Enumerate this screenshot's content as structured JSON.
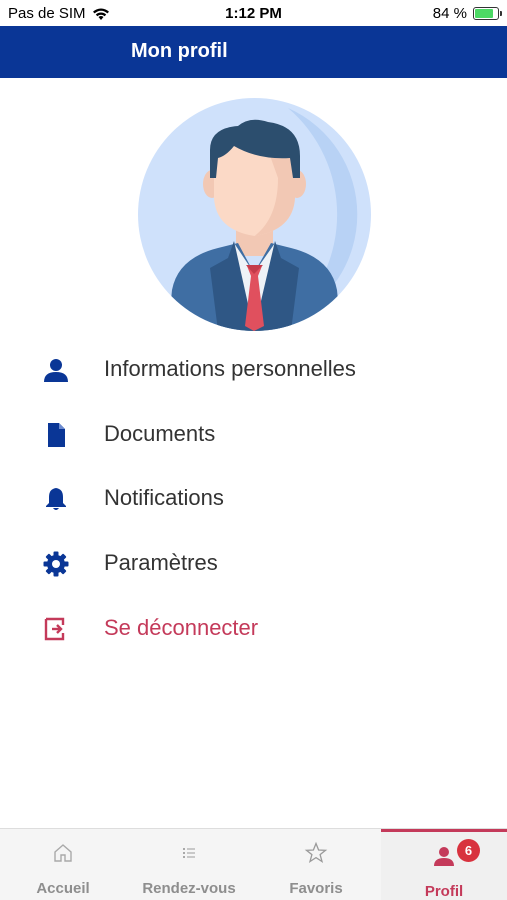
{
  "status_bar": {
    "carrier": "Pas de SIM",
    "time": "1:12 PM",
    "battery_text": "84 %",
    "battery_level": 0.84
  },
  "app_bar": {
    "title": "Mon profil"
  },
  "avatar": {
    "icon": "businessman-avatar-icon"
  },
  "menu": {
    "items": [
      {
        "label": "Informations personnelles",
        "icon": "user-icon"
      },
      {
        "label": "Documents",
        "icon": "document-icon"
      },
      {
        "label": "Notifications",
        "icon": "bell-icon"
      },
      {
        "label": "Paramètres",
        "icon": "gear-icon"
      },
      {
        "label": "Se déconnecter",
        "icon": "logout-icon"
      }
    ]
  },
  "bottom_nav": {
    "items": [
      {
        "label": "Accueil",
        "icon": "home-icon",
        "active": false
      },
      {
        "label": "Rendez-vous",
        "icon": "list-icon",
        "active": false
      },
      {
        "label": "Favoris",
        "icon": "star-icon",
        "active": false
      },
      {
        "label": "Profil",
        "icon": "user-icon",
        "active": true,
        "badge": "6"
      }
    ]
  },
  "colors": {
    "primary": "#0a3696",
    "accent": "#c43a5a",
    "badge": "#d8323e"
  }
}
